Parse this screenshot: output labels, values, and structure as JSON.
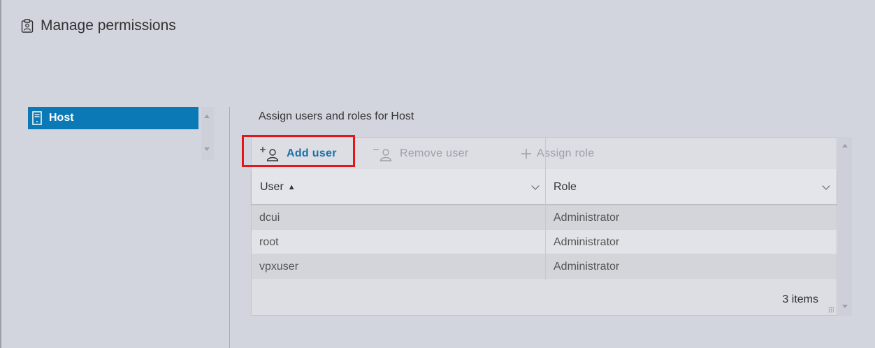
{
  "dialog": {
    "title": "Manage permissions",
    "title_icon": "clipboard-user-icon"
  },
  "tree": {
    "items": [
      {
        "label": "Host",
        "icon": "host-server-icon",
        "selected": true
      }
    ]
  },
  "section": {
    "title": "Assign users and roles for Host"
  },
  "toolbar": {
    "add_user": "Add user",
    "remove_user": "Remove user",
    "assign_role": "Assign role"
  },
  "grid": {
    "columns": [
      {
        "label": "User",
        "sort": "ascending"
      },
      {
        "label": "Role"
      }
    ],
    "rows": [
      {
        "user": "dcui",
        "role": "Administrator"
      },
      {
        "user": "root",
        "role": "Administrator"
      },
      {
        "user": "vpxuser",
        "role": "Administrator"
      }
    ],
    "footer_count": "3 items"
  },
  "colors": {
    "selected_bg": "#0b79b5",
    "link_blue": "#1b72a8",
    "disabled": "#9aa0aa",
    "highlight_red": "#e3161b",
    "background": "#d2d5de"
  }
}
